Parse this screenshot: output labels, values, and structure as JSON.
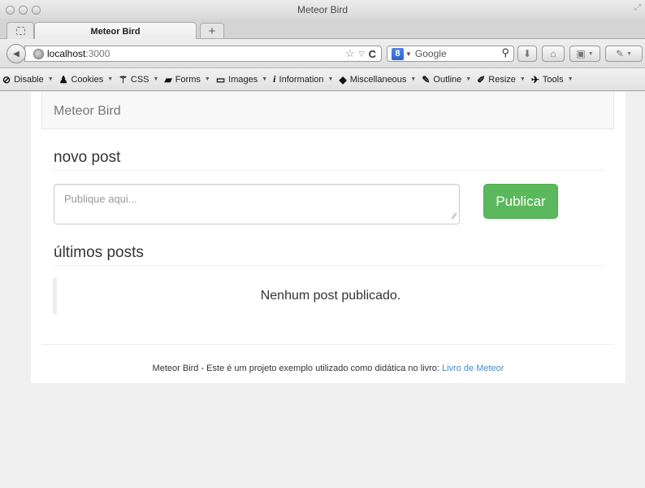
{
  "window": {
    "title": "Meteor Bird"
  },
  "tabs": [
    {
      "label": "Meteor Bird"
    }
  ],
  "address_bar": {
    "host": "localhost",
    "port": ":3000"
  },
  "search": {
    "engine": "Google",
    "engine_badge": "8"
  },
  "dev_toolbar": {
    "items": [
      {
        "label": "Disable",
        "icon": "no-entry-icon"
      },
      {
        "label": "Cookies",
        "icon": "person-icon"
      },
      {
        "label": "CSS",
        "icon": "wand-icon"
      },
      {
        "label": "Forms",
        "icon": "briefcase-icon"
      },
      {
        "label": "Images",
        "icon": "image-icon"
      },
      {
        "label": "Information",
        "icon": "info-icon"
      },
      {
        "label": "Miscellaneous",
        "icon": "box-icon"
      },
      {
        "label": "Outline",
        "icon": "pencil-icon"
      },
      {
        "label": "Resize",
        "icon": "resize-pencil-icon"
      },
      {
        "label": "Tools",
        "icon": "wrench-icon"
      }
    ]
  },
  "app": {
    "brand": "Meteor Bird",
    "new_post": {
      "heading": "novo post",
      "placeholder": "Publique aqui...",
      "submit_label": "Publicar"
    },
    "latest": {
      "heading": "últimos posts",
      "empty_message": "Nenhum post publicado."
    },
    "footer": {
      "text": "Meteor Bird - Este é um projeto exemplo utilizado como didática no livro: ",
      "link_text": "Livro de Meteor"
    }
  },
  "colors": {
    "primary_button": "#5cb85c",
    "link": "#428bca"
  }
}
